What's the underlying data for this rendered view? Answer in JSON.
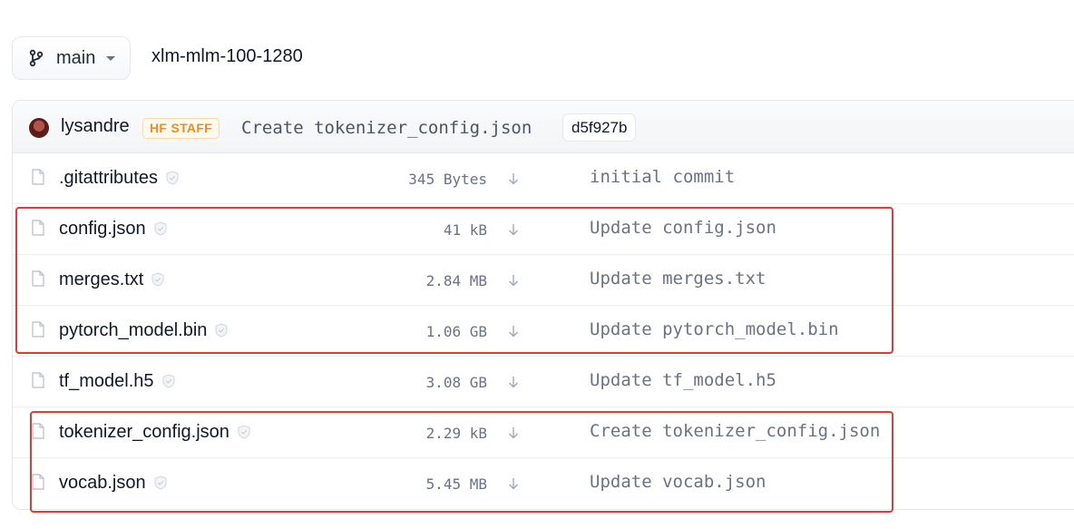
{
  "branch": {
    "label": "main"
  },
  "repo": {
    "path": "xlm-mlm-100-1280"
  },
  "commit": {
    "author": "lysandre",
    "badge": "HF STAFF",
    "message": "Create tokenizer_config.json",
    "hash": "d5f927b"
  },
  "files": [
    {
      "name": ".gitattributes",
      "size": "345 Bytes",
      "message": "initial commit"
    },
    {
      "name": "config.json",
      "size": "41 kB",
      "message": "Update config.json"
    },
    {
      "name": "merges.txt",
      "size": "2.84 MB",
      "message": "Update merges.txt"
    },
    {
      "name": "pytorch_model.bin",
      "size": "1.06 GB",
      "message": "Update pytorch_model.bin"
    },
    {
      "name": "tf_model.h5",
      "size": "3.08 GB",
      "message": "Update tf_model.h5"
    },
    {
      "name": "tokenizer_config.json",
      "size": "2.29 kB",
      "message": "Create tokenizer_config.json"
    },
    {
      "name": "vocab.json",
      "size": "5.45 MB",
      "message": "Update vocab.json"
    }
  ],
  "colors": {
    "highlight": "#e53935",
    "badge": "#f08c1a"
  },
  "icons": {
    "branch": "git-branch-icon",
    "file": "file-icon",
    "safe": "shield-check-icon",
    "download": "download-arrow-icon"
  }
}
